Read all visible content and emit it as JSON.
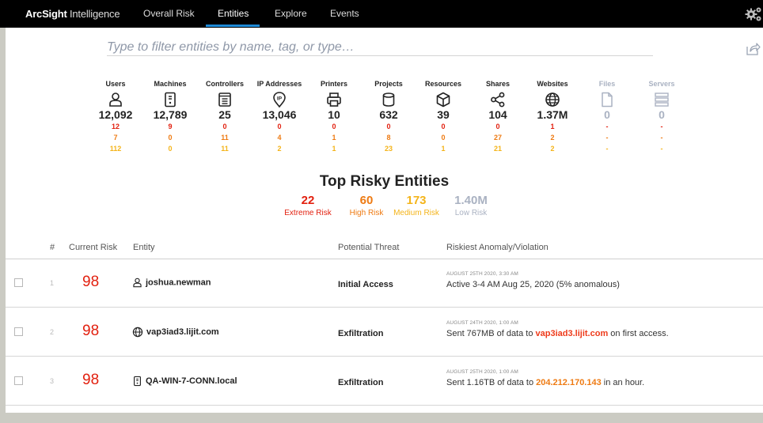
{
  "brand": {
    "bold": "ArcSight",
    "rest": " Intelligence"
  },
  "nav": [
    {
      "label": "Overall Risk"
    },
    {
      "label": "Entities"
    },
    {
      "label": "Explore"
    },
    {
      "label": "Events"
    }
  ],
  "nav_active": "Entities",
  "filter": {
    "placeholder": "Type to filter entities by name, tag, or type…",
    "value": ""
  },
  "entity_types": [
    {
      "label": "Users",
      "icon": "user-icon",
      "count": "12,092",
      "extreme": "12",
      "high": "7",
      "medium": "112"
    },
    {
      "label": "Machines",
      "icon": "machine-icon",
      "count": "12,789",
      "extreme": "9",
      "high": "0",
      "medium": "0"
    },
    {
      "label": "Controllers",
      "icon": "controller-icon",
      "count": "25",
      "extreme": "0",
      "high": "11",
      "medium": "11"
    },
    {
      "label": "IP Addresses",
      "icon": "ip-address-icon",
      "count": "13,046",
      "extreme": "0",
      "high": "4",
      "medium": "2"
    },
    {
      "label": "Printers",
      "icon": "printer-icon",
      "count": "10",
      "extreme": "0",
      "high": "1",
      "medium": "1"
    },
    {
      "label": "Projects",
      "icon": "database-icon",
      "count": "632",
      "extreme": "0",
      "high": "8",
      "medium": "23"
    },
    {
      "label": "Resources",
      "icon": "cube-icon",
      "count": "39",
      "extreme": "0",
      "high": "0",
      "medium": "1"
    },
    {
      "label": "Shares",
      "icon": "share-icon",
      "count": "104",
      "extreme": "0",
      "high": "27",
      "medium": "21"
    },
    {
      "label": "Websites",
      "icon": "globe-icon",
      "count": "1.37M",
      "extreme": "1",
      "high": "2",
      "medium": "2"
    },
    {
      "label": "Files",
      "icon": "file-icon",
      "count": "0",
      "extreme": "-",
      "high": "-",
      "medium": "-"
    },
    {
      "label": "Servers",
      "icon": "server-icon",
      "count": "0",
      "extreme": "-",
      "high": "-",
      "medium": "-"
    }
  ],
  "top_risky": {
    "title": "Top Risky Entities",
    "stats": [
      {
        "value": "22",
        "label": "Extreme Risk",
        "color": "#e2200f"
      },
      {
        "value": "60",
        "label": "High Risk",
        "color": "#ee7a12"
      },
      {
        "value": "173",
        "label": "Medium Risk",
        "color": "#f4b41a"
      },
      {
        "value": "1.40M",
        "label": "Low Risk",
        "color": "#aab2c2"
      }
    ]
  },
  "table": {
    "headers": {
      "num": "#",
      "risk": "Current Risk",
      "entity": "Entity",
      "threat": "Potential Threat",
      "anomaly": "Riskiest Anomaly/Violation"
    },
    "rows": [
      {
        "num": "1",
        "risk": "98",
        "entity_icon": "user-icon",
        "entity": "joshua.newman",
        "threat": "Initial Access",
        "timestamp": "AUGUST 25TH 2020, 3:30 AM",
        "desc_pre": "Active 3-4 AM Aug 25, 2020 (5% anomalous)",
        "desc_hl": "",
        "desc_post": ""
      },
      {
        "num": "2",
        "risk": "98",
        "entity_icon": "globe-icon",
        "entity": "vap3iad3.lijit.com",
        "threat": "Exfiltration",
        "timestamp": "AUGUST 24TH 2020, 1:00 AM",
        "desc_pre": "Sent 767MB of data to ",
        "desc_hl": "vap3iad3.lijit.com",
        "desc_post": " on first access."
      },
      {
        "num": "3",
        "risk": "98",
        "entity_icon": "machine-icon",
        "entity": "QA-WIN-7-CONN.local",
        "threat": "Exfiltration",
        "timestamp": "AUGUST 25TH 2020, 1:00 AM",
        "desc_pre": "Sent 1.16TB of data to ",
        "desc_hl": "204.212.170.143",
        "desc_post": " in an hour."
      }
    ]
  }
}
